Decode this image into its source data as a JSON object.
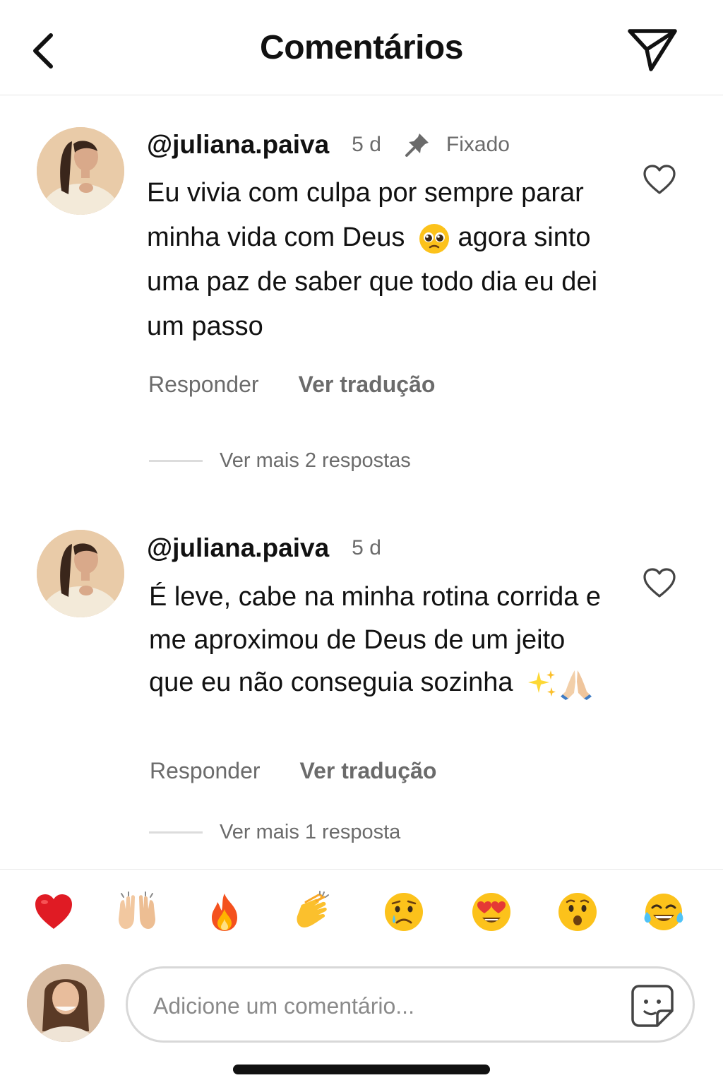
{
  "header": {
    "title": "Comentários"
  },
  "comments": [
    {
      "username": "@juliana.paiva",
      "time": "5 d",
      "pinned_label": "Fixado",
      "text": "Eu vivia com culpa por sempre parar minha vida com Deus",
      "text_after_emoji": "agora sinto uma paz de saber que todo dia eu dei um passo",
      "emoji": "pleading-face",
      "reply_label": "Responder",
      "translate_label": "Ver tradução",
      "more_replies": "Ver mais 2 respostas"
    },
    {
      "username": "@juliana.paiva",
      "time": "5 d",
      "text": "É leve, cabe na minha rotina corrida e me aproximou de Deus de um jeito que eu não conseguia sozinha",
      "emojis": [
        "sparkles",
        "folded-hands"
      ],
      "reply_label": "Responder",
      "translate_label": "Ver tradução",
      "more_replies": "Ver mais 1 resposta"
    }
  ],
  "reactions": [
    "red-heart",
    "raising-hands",
    "fire",
    "clapping-hands",
    "crying-face",
    "heart-eyes-face",
    "astonished-face",
    "tears-of-joy-face"
  ],
  "composer": {
    "placeholder": "Adicione um comentário...",
    "value": ""
  },
  "colors": {
    "text": "#111111",
    "secondary": "#6b6b6b",
    "divider": "#e6e6e6"
  }
}
